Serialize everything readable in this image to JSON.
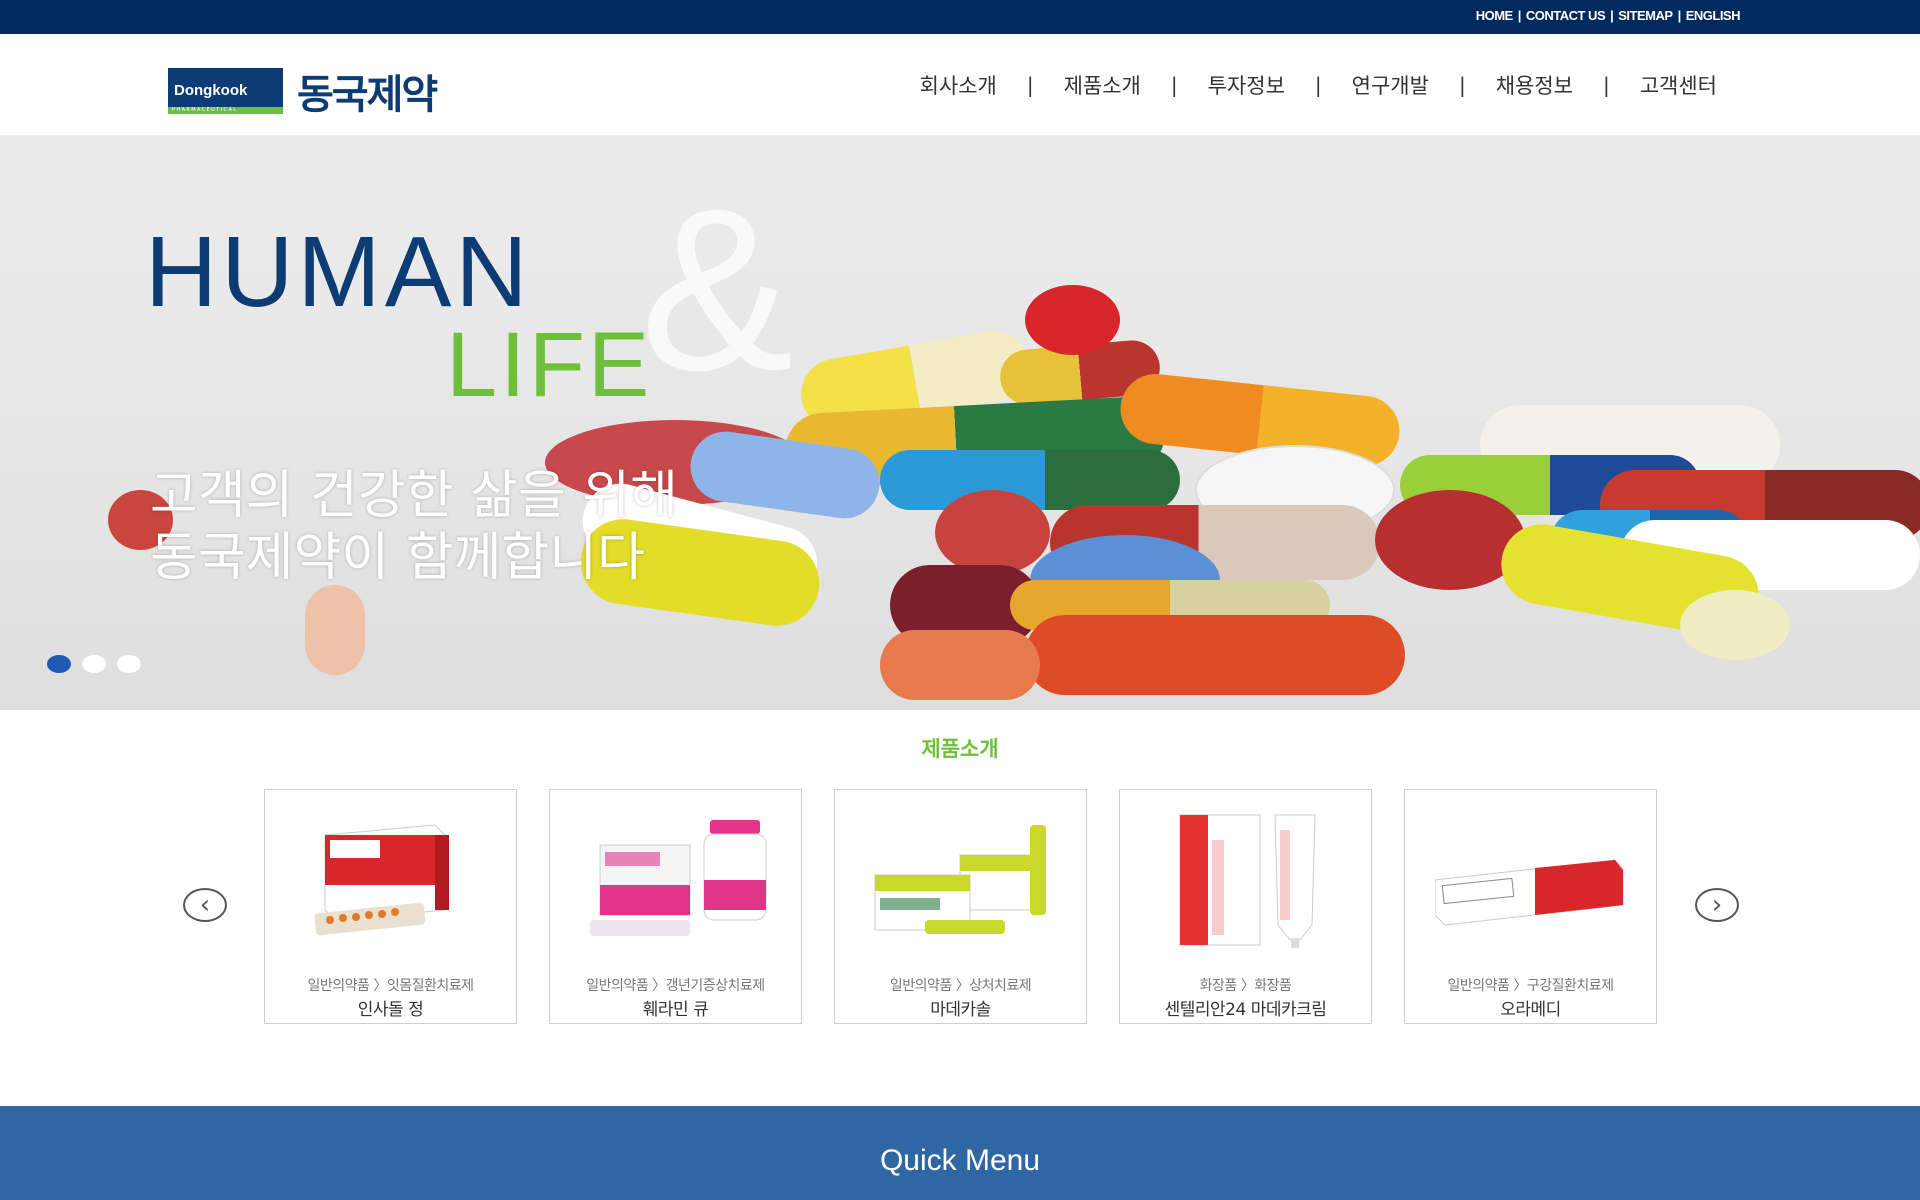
{
  "topbar": {
    "links": [
      "HOME",
      "CONTACT US",
      "SITEMAP",
      "ENGLISH"
    ]
  },
  "header": {
    "logo_en": "Dongkook",
    "logo_sub": "PHARMACEUTICAL",
    "logo_ko": "동국제약",
    "nav": [
      "회사소개",
      "제품소개",
      "투자정보",
      "연구개발",
      "채용정보",
      "고객센터"
    ],
    "nav_separator": "|"
  },
  "hero": {
    "human": "HUMAN",
    "amp": "&",
    "life": "LIFE",
    "subtitle_line1": "고객의 건강한 삶을 위해",
    "subtitle_line2": "동국제약이 함께합니다",
    "slides_total": 3,
    "slide_active": 1
  },
  "products": {
    "title": "제품소개",
    "prev_arrow": "‹",
    "next_arrow": "›",
    "items": [
      {
        "category": "일반의약품 〉잇몸질환치료제",
        "name": "인사돌 정"
      },
      {
        "category": "일반의약품 〉갱년기증상치료제",
        "name": "훼라민 큐"
      },
      {
        "category": "일반의약품 〉상처치료제",
        "name": "마데카솔"
      },
      {
        "category": "화장품 〉화장품",
        "name": "센텔리안24 마데카크림"
      },
      {
        "category": "일반의약품 〉구강질환치료제",
        "name": "오라메디"
      }
    ]
  },
  "quick": {
    "title": "Quick Menu"
  },
  "colors": {
    "navy": "#032a5d",
    "brand_blue": "#0d3c74",
    "brand_green": "#70bf3c",
    "quick_blue": "#2f67a5"
  }
}
